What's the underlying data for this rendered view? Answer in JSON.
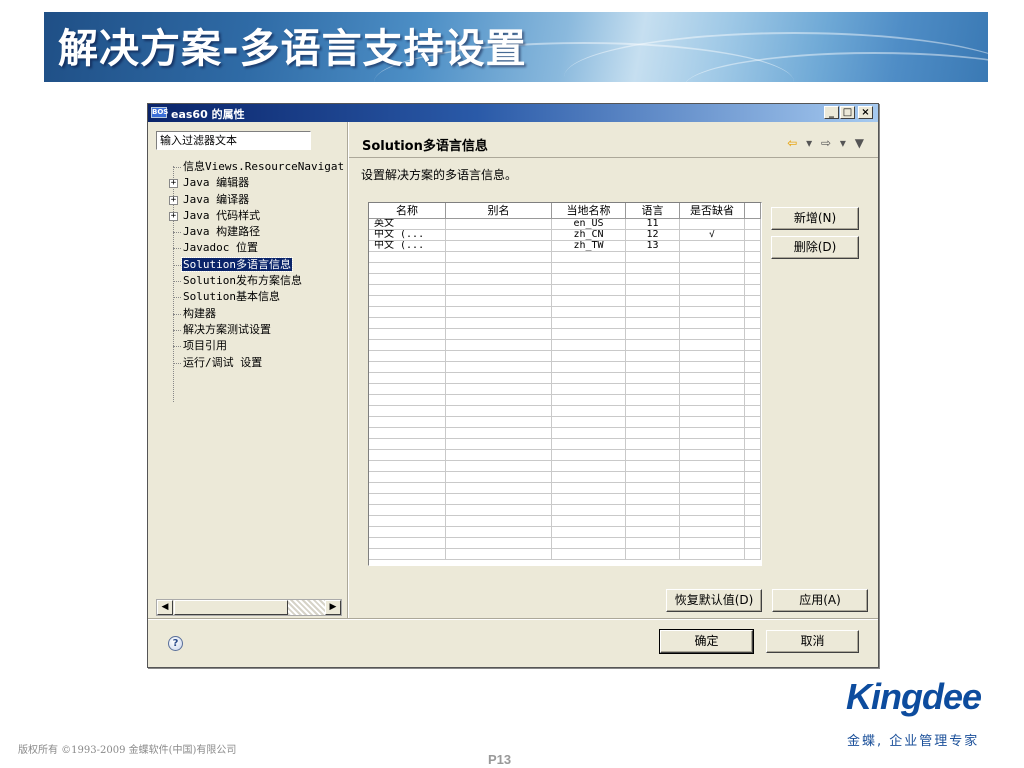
{
  "slide": {
    "title": "解决方案-多语言支持设置",
    "page_number": "P13",
    "copyright": "版权所有 ©1993-2009 金蝶软件(中国)有限公司",
    "logo_text": "Kingdee",
    "tagline": "金蝶, 企业管理专家"
  },
  "dialog": {
    "app_icon_text": "BOS",
    "title": "eas60 的属性",
    "window_buttons": [
      "_",
      "□",
      "×"
    ],
    "filter_value": "输入过滤器文本",
    "tree": [
      {
        "label": "信息Views.ResourceNavigat",
        "expandable": false,
        "selected": false
      },
      {
        "label": "Java 编辑器",
        "expandable": true,
        "selected": false
      },
      {
        "label": "Java 编译器",
        "expandable": true,
        "selected": false
      },
      {
        "label": "Java 代码样式",
        "expandable": true,
        "selected": false
      },
      {
        "label": "Java 构建路径",
        "expandable": false,
        "selected": false
      },
      {
        "label": "Javadoc 位置",
        "expandable": false,
        "selected": false
      },
      {
        "label": "Solution多语言信息",
        "expandable": false,
        "selected": true
      },
      {
        "label": "Solution发布方案信息",
        "expandable": false,
        "selected": false
      },
      {
        "label": "Solution基本信息",
        "expandable": false,
        "selected": false
      },
      {
        "label": "构建器",
        "expandable": false,
        "selected": false
      },
      {
        "label": "解决方案测试设置",
        "expandable": false,
        "selected": false
      },
      {
        "label": "项目引用",
        "expandable": false,
        "selected": false
      },
      {
        "label": "运行/调试 设置",
        "expandable": false,
        "selected": false
      }
    ],
    "expand_symbol": "+",
    "scroll_left": "◀",
    "scroll_right": "▶",
    "page_title": "Solution多语言信息",
    "nav_icons": {
      "back": "⇦",
      "back_menu": "▾",
      "forward": "⇨",
      "forward_menu": "▾",
      "view_menu": "▼"
    },
    "description": "设置解决方案的多语言信息。",
    "table": {
      "columns": [
        "名称",
        "别名",
        "当地名称",
        "语言",
        "是否缺省"
      ],
      "rows": [
        [
          "英文",
          "",
          "en_US",
          "11",
          ""
        ],
        [
          "中文 (...",
          "",
          "zh_CN",
          "12",
          "√"
        ],
        [
          "中文 (...",
          "",
          "zh_TW",
          "13",
          ""
        ]
      ]
    },
    "buttons": {
      "add": "新增(N)",
      "delete": "删除(D)",
      "restore_defaults": "恢复默认值(D)",
      "apply": "应用(A)",
      "ok": "确定",
      "cancel": "取消"
    },
    "help_icon": "?"
  }
}
